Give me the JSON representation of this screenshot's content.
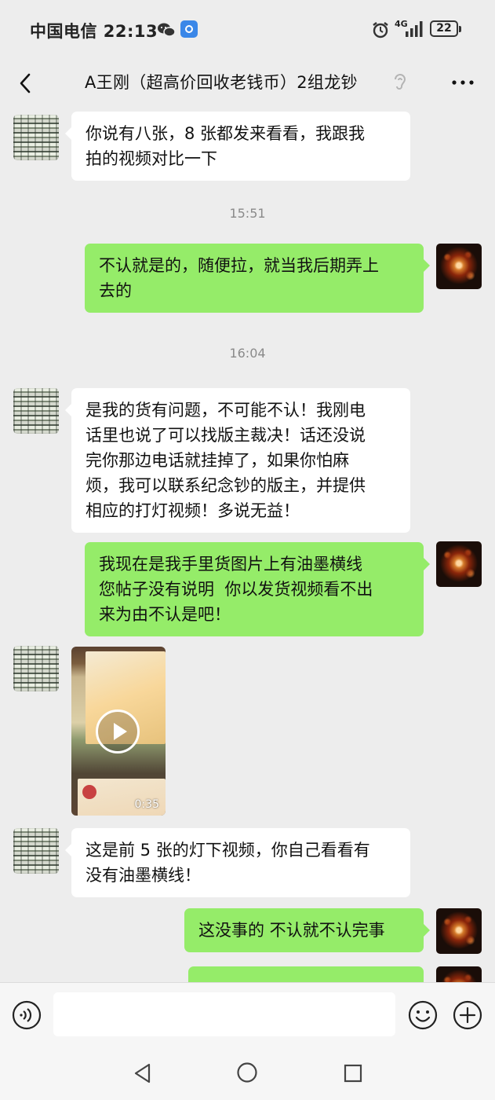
{
  "status_bar": {
    "carrier_time": "中国电信 22:13",
    "network": "4G",
    "battery": "22"
  },
  "header": {
    "title": "A王刚（超高价回收老钱币）2组龙钞"
  },
  "messages": [
    {
      "type": "text",
      "side": "other",
      "text": "你说有八张，8 张都发来看看，我跟我\n拍的视频对比一下"
    },
    {
      "type": "time",
      "text": "15:51"
    },
    {
      "type": "text",
      "side": "self",
      "text": "不认就是的，随便拉，就当我后期弄上\n去的"
    },
    {
      "type": "time",
      "text": "16:04"
    },
    {
      "type": "text",
      "side": "other",
      "text": "是我的货有问题，不可能不认！我刚电\n话里也说了可以找版主裁决！话还没说\n完你那边电话就挂掉了，如果你怕麻\n烦，我可以联系纪念钞的版主，并提供\n相应的打灯视频！多说无益！"
    },
    {
      "type": "text",
      "side": "self",
      "text": "我现在是我手里货图片上有油墨横线\n您帖子没有说明  你以发货视频看不出\n来为由不认是吧！"
    },
    {
      "type": "video",
      "side": "other",
      "duration": "0:35"
    },
    {
      "type": "text",
      "side": "other",
      "text": "这是前 5 张的灯下视频，你自己看看有\n没有油墨横线！"
    },
    {
      "type": "text",
      "side": "self",
      "text": "这没事的 不认就不认完事"
    }
  ],
  "input": {
    "placeholder": ""
  },
  "colors": {
    "background": "#ededed",
    "self_bubble": "#95ec69",
    "other_bubble": "#ffffff",
    "timestamp": "#8a8a8a"
  },
  "icons": [
    "back-icon",
    "wechat-icon",
    "app-icon",
    "alarm-icon",
    "signal-icon",
    "battery-icon",
    "ear-icon",
    "more-icon",
    "voice-icon",
    "emoji-icon",
    "plus-icon",
    "play-icon",
    "nav-back-icon",
    "nav-home-icon",
    "nav-recent-icon"
  ]
}
